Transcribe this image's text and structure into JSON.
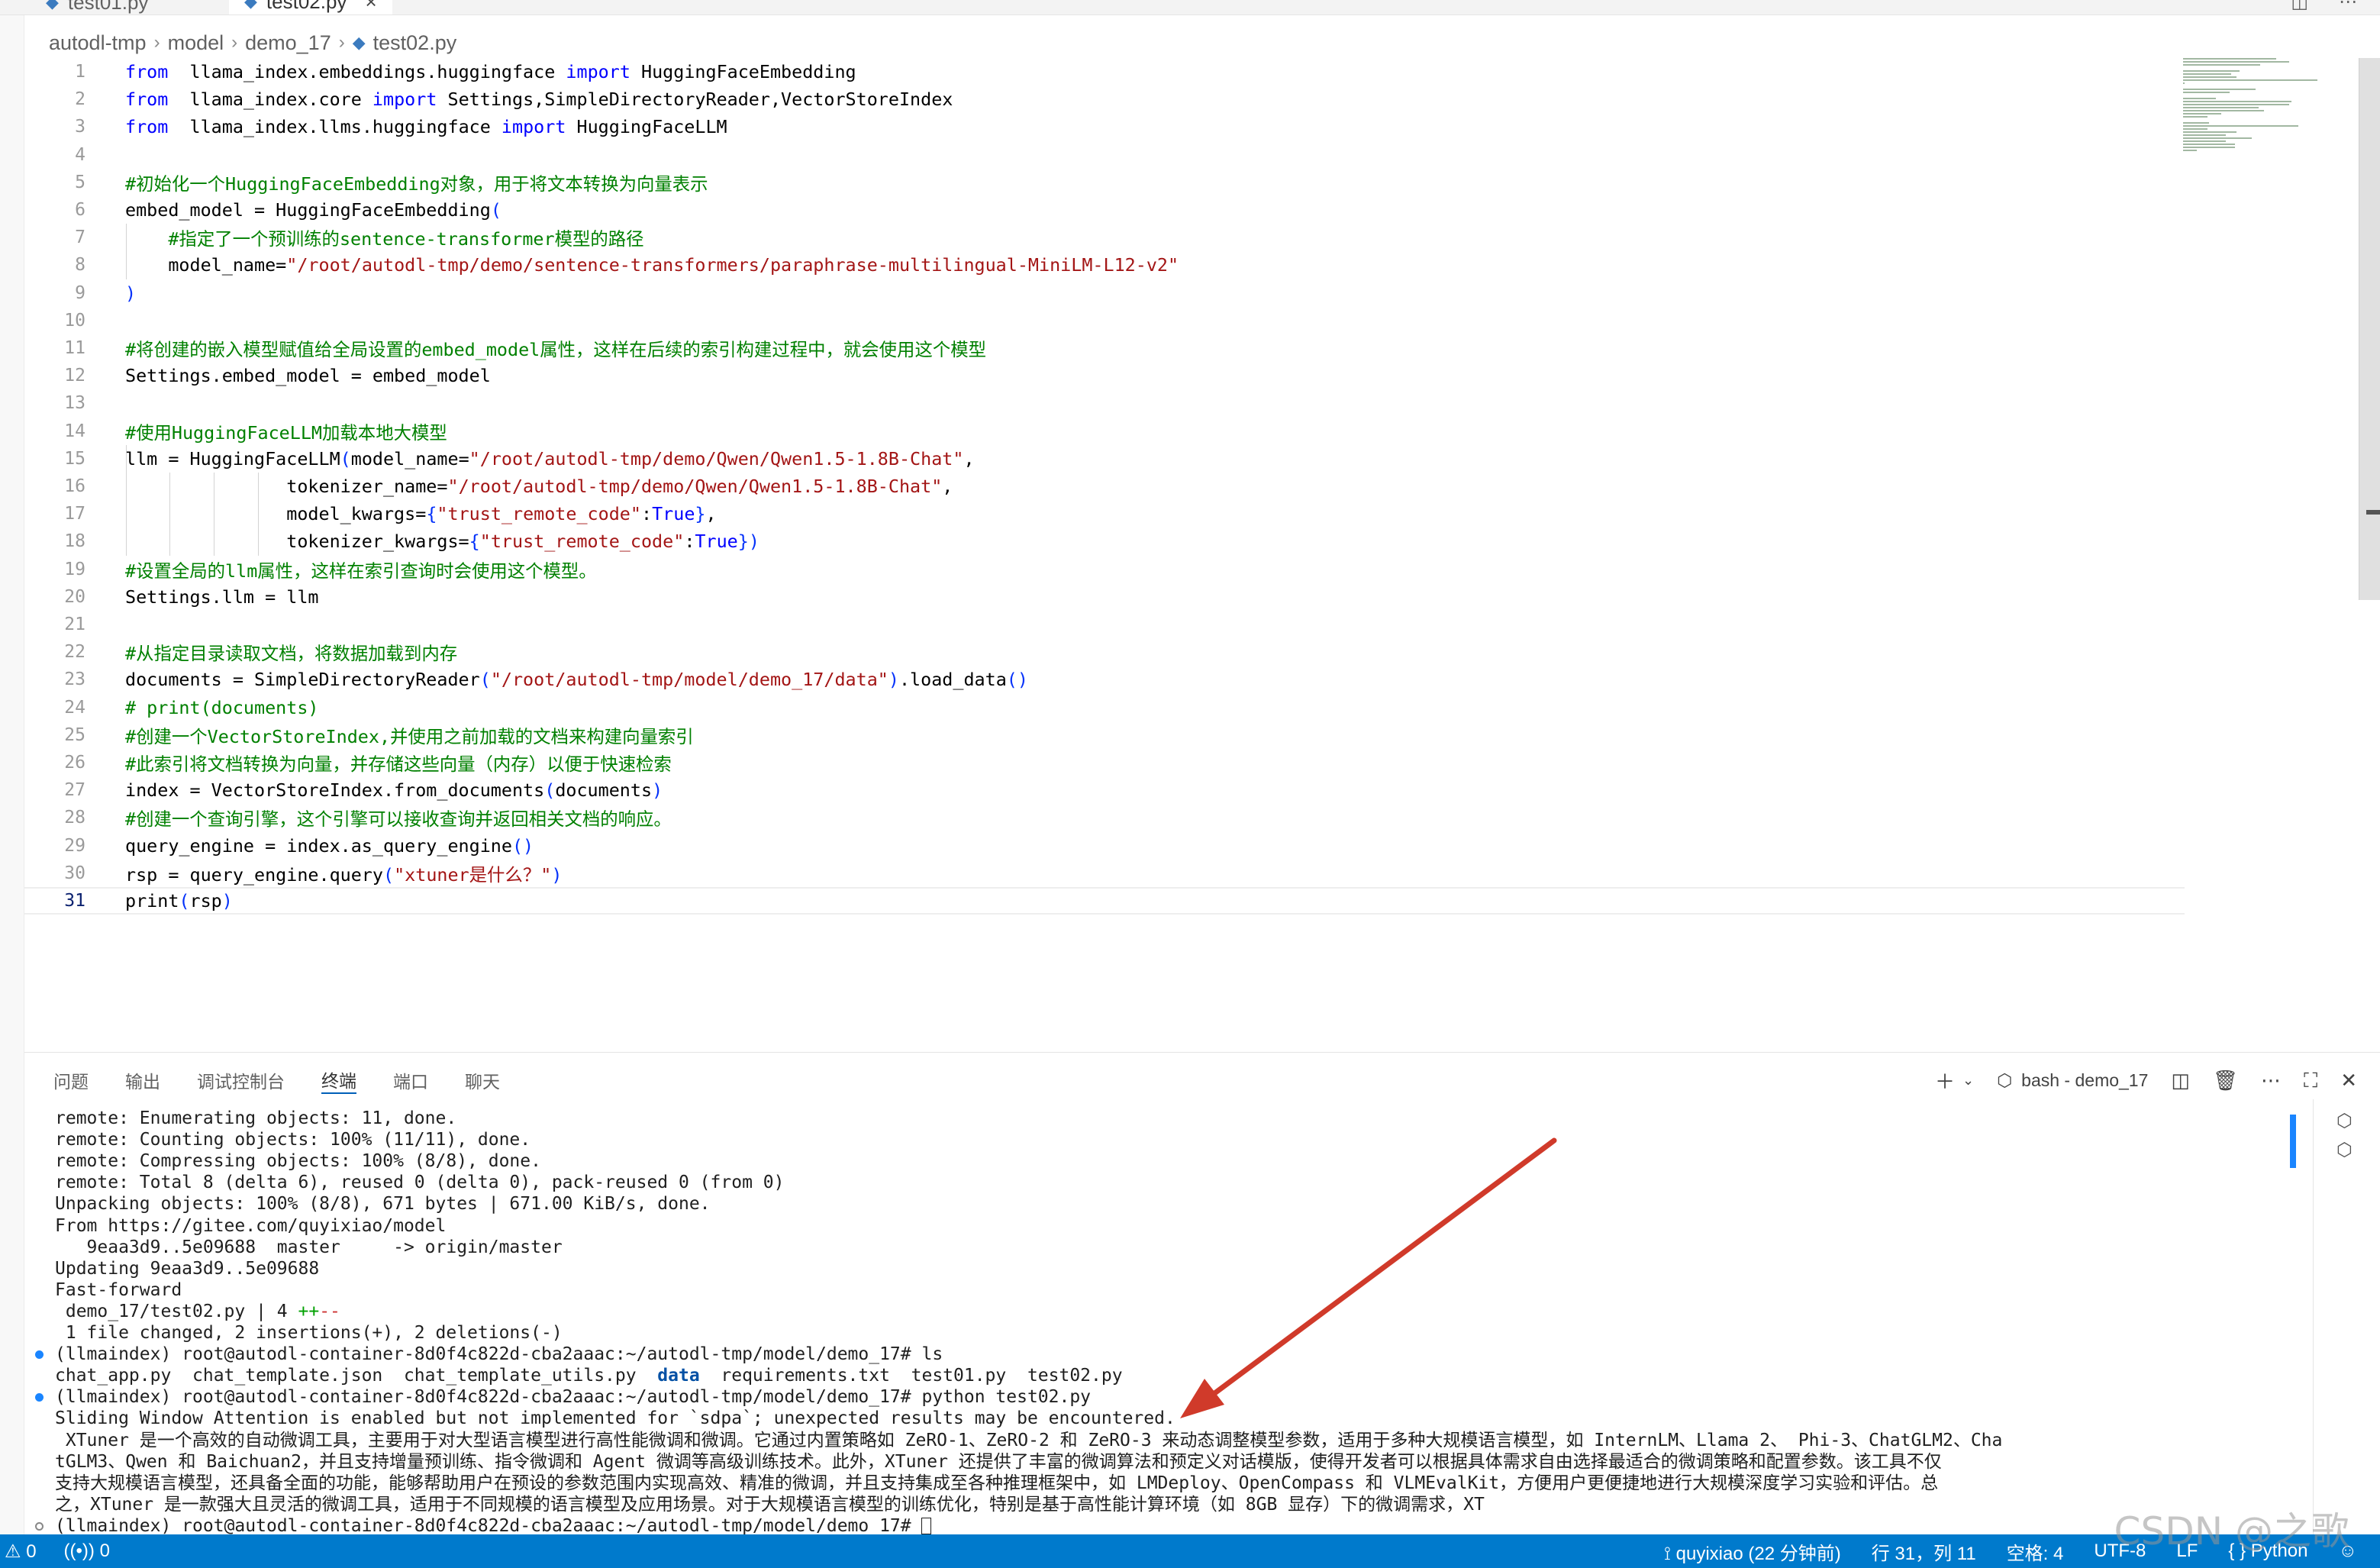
{
  "tabs": [
    {
      "label": "test01.py",
      "active": false
    },
    {
      "label": "test02.py",
      "active": true
    }
  ],
  "breadcrumb": [
    "autodl-tmp",
    "model",
    "demo_17",
    "test02.py"
  ],
  "editor": {
    "current_line": 31,
    "lines": [
      {
        "n": "1",
        "tokens": [
          [
            "kw",
            "from"
          ],
          [
            "",
            "  llama_index.embeddings.huggingface "
          ],
          [
            "kw",
            "import"
          ],
          [
            "",
            " HuggingFaceEmbedding"
          ]
        ]
      },
      {
        "n": "2",
        "tokens": [
          [
            "kw",
            "from"
          ],
          [
            "",
            "  llama_index.core "
          ],
          [
            "kw",
            "import"
          ],
          [
            "",
            " Settings,SimpleDirectoryReader,VectorStoreIndex"
          ]
        ]
      },
      {
        "n": "3",
        "tokens": [
          [
            "kw",
            "from"
          ],
          [
            "",
            "  llama_index.llms.huggingface "
          ],
          [
            "kw",
            "import"
          ],
          [
            "",
            " HuggingFaceLLM"
          ]
        ]
      },
      {
        "n": "4",
        "tokens": []
      },
      {
        "n": "5",
        "tokens": [
          [
            "cm",
            "#初始化一个HuggingFaceEmbedding对象，用于将文本转换为向量表示"
          ]
        ]
      },
      {
        "n": "6",
        "tokens": [
          [
            "",
            "embed_model = HuggingFaceEmbedding"
          ],
          [
            "br",
            "("
          ]
        ]
      },
      {
        "n": "7",
        "tokens": [
          [
            "",
            "    "
          ],
          [
            "cm",
            "#指定了一个预训练的sentence-transformer模型的路径"
          ]
        ]
      },
      {
        "n": "8",
        "tokens": [
          [
            "",
            "    model_name="
          ],
          [
            "st",
            "\"/root/autodl-tmp/demo/sentence-transformers/paraphrase-multilingual-MiniLM-L12-v2\""
          ]
        ]
      },
      {
        "n": "9",
        "tokens": [
          [
            "br",
            ")"
          ]
        ]
      },
      {
        "n": "10",
        "tokens": []
      },
      {
        "n": "11",
        "tokens": [
          [
            "cm",
            "#将创建的嵌入模型赋值给全局设置的embed_model属性，这样在后续的索引构建过程中，就会使用这个模型"
          ]
        ]
      },
      {
        "n": "12",
        "tokens": [
          [
            "",
            "Settings.embed_model = embed_model"
          ]
        ]
      },
      {
        "n": "13",
        "tokens": []
      },
      {
        "n": "14",
        "tokens": [
          [
            "cm",
            "#使用HuggingFaceLLM加载本地大模型"
          ]
        ]
      },
      {
        "n": "15",
        "tokens": [
          [
            "",
            "llm = HuggingFaceLLM"
          ],
          [
            "br",
            "("
          ],
          [
            "",
            "model_name="
          ],
          [
            "st",
            "\"/root/autodl-tmp/demo/Qwen/Qwen1.5-1.8B-Chat\""
          ],
          [
            "",
            ","
          ]
        ]
      },
      {
        "n": "16",
        "tokens": [
          [
            "",
            "               tokenizer_name="
          ],
          [
            "st",
            "\"/root/autodl-tmp/demo/Qwen/Qwen1.5-1.8B-Chat\""
          ],
          [
            "",
            ","
          ]
        ]
      },
      {
        "n": "17",
        "tokens": [
          [
            "",
            "               model_kwargs="
          ],
          [
            "br",
            "{"
          ],
          [
            "st",
            "\"trust_remote_code\""
          ],
          [
            "",
            ":"
          ],
          [
            "kw",
            "True"
          ],
          [
            "br",
            "}"
          ],
          [
            "",
            ","
          ]
        ]
      },
      {
        "n": "18",
        "tokens": [
          [
            "",
            "               tokenizer_kwargs="
          ],
          [
            "br",
            "{"
          ],
          [
            "st",
            "\"trust_remote_code\""
          ],
          [
            "",
            ":"
          ],
          [
            "kw",
            "True"
          ],
          [
            "br",
            "})"
          ]
        ]
      },
      {
        "n": "19",
        "tokens": [
          [
            "cm",
            "#设置全局的llm属性，这样在索引查询时会使用这个模型。"
          ]
        ]
      },
      {
        "n": "20",
        "tokens": [
          [
            "",
            "Settings.llm = llm"
          ]
        ]
      },
      {
        "n": "21",
        "tokens": []
      },
      {
        "n": "22",
        "tokens": [
          [
            "cm",
            "#从指定目录读取文档，将数据加载到内存"
          ]
        ]
      },
      {
        "n": "23",
        "tokens": [
          [
            "",
            "documents = SimpleDirectoryReader"
          ],
          [
            "br",
            "("
          ],
          [
            "st",
            "\"/root/autodl-tmp/model/demo_17/data\""
          ],
          [
            "br",
            ")"
          ],
          [
            "",
            ".load_data"
          ],
          [
            "br",
            "()"
          ]
        ]
      },
      {
        "n": "24",
        "tokens": [
          [
            "cm",
            "# print(documents)"
          ]
        ]
      },
      {
        "n": "25",
        "tokens": [
          [
            "cm",
            "#创建一个VectorStoreIndex,并使用之前加载的文档来构建向量索引"
          ]
        ]
      },
      {
        "n": "26",
        "tokens": [
          [
            "cm",
            "#此索引将文档转换为向量，并存储这些向量（内存）以便于快速检索"
          ]
        ]
      },
      {
        "n": "27",
        "tokens": [
          [
            "",
            "index = VectorStoreIndex.from_documents"
          ],
          [
            "br",
            "("
          ],
          [
            "",
            "documents"
          ],
          [
            "br",
            ")"
          ]
        ]
      },
      {
        "n": "28",
        "tokens": [
          [
            "cm",
            "#创建一个查询引擎，这个引擎可以接收查询并返回相关文档的响应。"
          ]
        ]
      },
      {
        "n": "29",
        "tokens": [
          [
            "",
            "query_engine = index.as_query_engine"
          ],
          [
            "br",
            "()"
          ]
        ]
      },
      {
        "n": "30",
        "tokens": [
          [
            "",
            "rsp = query_engine.query"
          ],
          [
            "br",
            "("
          ],
          [
            "st",
            "\"xtuner是什么？\""
          ],
          [
            "br",
            ")"
          ]
        ]
      },
      {
        "n": "31",
        "tokens": [
          [
            "",
            "print"
          ],
          [
            "br",
            "("
          ],
          [
            "",
            "rsp"
          ],
          [
            "br",
            ")"
          ]
        ]
      }
    ]
  },
  "panel": {
    "tabs": [
      "问题",
      "输出",
      "调试控制台",
      "终端",
      "端口",
      "聊天"
    ],
    "active_tab": "终端",
    "terminal_name": "bash - demo_17"
  },
  "terminal": {
    "lines": [
      {
        "dot": "",
        "text": "remote: Enumerating objects: 11, done."
      },
      {
        "dot": "",
        "text": "remote: Counting objects: 100% (11/11), done."
      },
      {
        "dot": "",
        "text": "remote: Compressing objects: 100% (8/8), done."
      },
      {
        "dot": "",
        "text": "remote: Total 8 (delta 6), reused 0 (delta 0), pack-reused 0 (from 0)"
      },
      {
        "dot": "",
        "text": "Unpacking objects: 100% (8/8), 671 bytes | 671.00 KiB/s, done."
      },
      {
        "dot": "",
        "text": "From https://gitee.com/quyixiao/model"
      },
      {
        "dot": "",
        "text": "   9eaa3d9..5e09688  master     -> origin/master"
      },
      {
        "dot": "",
        "text": "Updating 9eaa3d9..5e09688"
      },
      {
        "dot": "",
        "text": "Fast-forward"
      },
      {
        "dot": "",
        "text": " demo_17/test02.py | 4 ",
        "green": "++",
        "red": "--"
      },
      {
        "dot": "",
        "text": " 1 file changed, 2 insertions(+), 2 deletions(-)"
      },
      {
        "dot": "blue",
        "text": "(llmaindex) root@autodl-container-8d0f4c822d-cba2aaac:~/autodl-tmp/model/demo_17# ls"
      },
      {
        "dot": "",
        "text": "chat_app.py  chat_template.json  chat_template_utils.py  ",
        "bold": "data",
        "after": "  requirements.txt  test01.py  test02.py"
      },
      {
        "dot": "blue",
        "text": "(llmaindex) root@autodl-container-8d0f4c822d-cba2aaac:~/autodl-tmp/model/demo_17# python test02.py"
      },
      {
        "dot": "",
        "text": "Sliding Window Attention is enabled but not implemented for `sdpa`; unexpected results may be encountered."
      },
      {
        "dot": "",
        "text": " XTuner 是一个高效的自动微调工具，主要用于对大型语言模型进行高性能微调和微调。它通过内置策略如 ZeRO-1、ZeRO-2 和 ZeRO-3 来动态调整模型参数，适用于多种大规模语言模型，如 InternLM、Llama 2、 Phi-3、ChatGLM2、Cha"
      },
      {
        "dot": "",
        "text": "tGLM3、Qwen 和 Baichuan2，并且支持增量预训练、指令微调和 Agent 微调等高级训练技术。此外，XTuner 还提供了丰富的微调算法和预定义对话模版，使得开发者可以根据具体需求自由选择最适合的微调策略和配置参数。该工具不仅"
      },
      {
        "dot": "",
        "text": "支持大规模语言模型，还具备全面的功能，能够帮助用户在预设的参数范围内实现高效、精准的微调，并且支持集成至各种推理框架中，如 LMDeploy、OpenCompass 和 VLMEvalKit，方便用户更便捷地进行大规模深度学习实验和评估。总"
      },
      {
        "dot": "",
        "text": "之，XTuner 是一款强大且灵活的微调工具，适用于不同规模的语言模型及应用场景。对于大规模语言模型的训练优化，特别是基于高性能计算环境（如 8GB 显存）下的微调需求，XT"
      },
      {
        "dot": "hollow",
        "text": "(llmaindex) root@autodl-container-8d0f4c822d-cba2aaac:~/autodl-tmp/model/demo_17# ",
        "cursor": true
      }
    ]
  },
  "statusbar": {
    "errors": "0",
    "ports": "0",
    "user": "quyixiao (22 分钟前)",
    "position": "行 31，列 11",
    "spaces": "空格: 4",
    "encoding": "UTF-8",
    "eol": "LF",
    "language": "Python"
  },
  "watermark": "CSDN @之歌",
  "colors": {
    "keyword": "#0000ff",
    "comment": "#008000",
    "string": "#a31515",
    "statusbar": "#007acc",
    "arrow": "#d03a2a"
  }
}
